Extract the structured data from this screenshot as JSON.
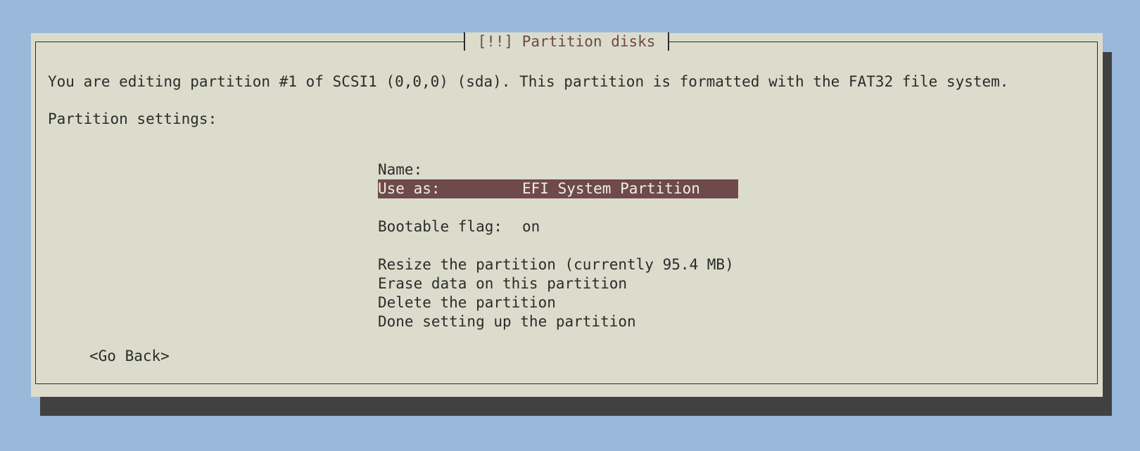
{
  "dialog": {
    "title": "[!!] Partition disks",
    "description": "You are editing partition #1 of SCSI1 (0,0,0) (sda). This partition is formatted with the FAT32 file system.",
    "settings_label": "Partition settings:"
  },
  "menu": {
    "name_label": "Name:",
    "name_value": "",
    "use_as_label": "Use as:",
    "use_as_value": "EFI System Partition",
    "bootable_label": "Bootable flag:",
    "bootable_value": "on",
    "actions": [
      "Resize the partition (currently 95.4 MB)",
      "Erase data on this partition",
      "Delete the partition",
      "Done setting up the partition"
    ]
  },
  "buttons": {
    "go_back": "<Go Back>"
  },
  "colors": {
    "background": "#9ab8d9",
    "dialog": "#dcdccc",
    "shadow": "#414141",
    "selection": "#6e4a4a",
    "title_text": "#6e4a44"
  }
}
